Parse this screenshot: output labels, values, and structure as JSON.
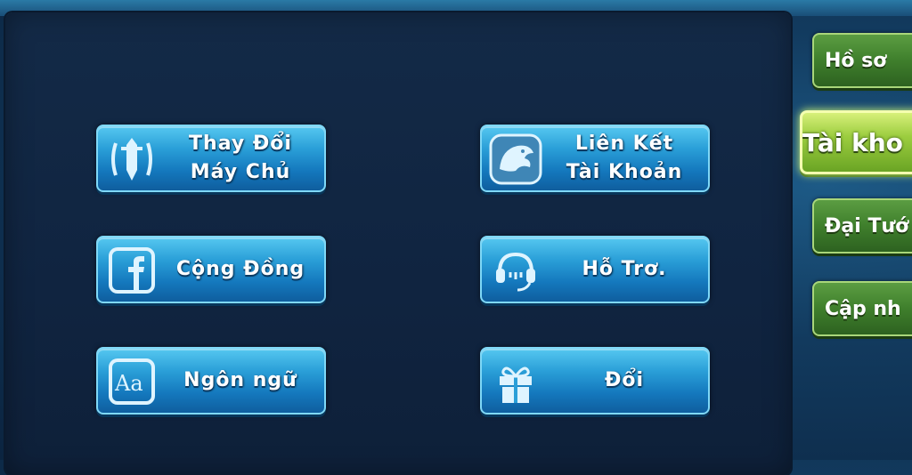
{
  "menu": {
    "buttons": [
      {
        "line1": "Thay Đổi",
        "line2": "Máy Chủ",
        "icon": "sword-shield-icon"
      },
      {
        "line1": "Liên Kết",
        "line2": "Tài Khoản",
        "icon": "dragon-icon"
      },
      {
        "line1": "Cộng Đồng",
        "line2": "",
        "icon": "facebook-icon"
      },
      {
        "line1": "Hỗ Trơ.",
        "line2": "",
        "icon": "headset-icon"
      },
      {
        "line1": "Ngôn ngữ",
        "line2": "",
        "icon": "language-icon"
      },
      {
        "line1": "Đổi",
        "line2": "",
        "icon": "gift-icon"
      }
    ]
  },
  "sidebar": {
    "tabs": [
      {
        "label": "Hồ sơ"
      },
      {
        "label": "Tài kho",
        "active": true
      },
      {
        "label": "Đại Tướ"
      },
      {
        "label": "Cập nh"
      }
    ]
  },
  "colors": {
    "button_blue": "#1e8ccc",
    "tab_green": "#3f7f2c",
    "tab_active": "#9ccd3f",
    "panel": "#112642"
  }
}
